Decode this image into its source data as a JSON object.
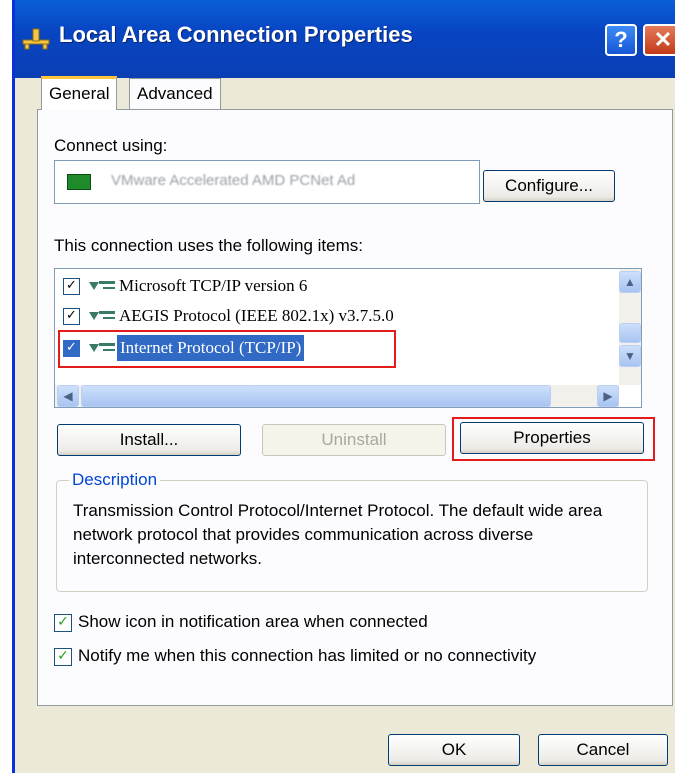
{
  "window": {
    "title": "Local Area Connection Properties",
    "help_glyph": "?",
    "close_glyph": "✕"
  },
  "tabs": [
    {
      "label": "General",
      "active": true
    },
    {
      "label": "Advanced",
      "active": false
    }
  ],
  "connect_using": {
    "label": "Connect using:",
    "device_name": "VMware Accelerated AMD PCNet Ad",
    "configure_button": "Configure..."
  },
  "items_section": {
    "label": "This connection uses the following items:",
    "items": [
      {
        "label": "Microsoft TCP/IP version 6",
        "checked": true,
        "selected": false
      },
      {
        "label": "AEGIS Protocol (IEEE 802.1x) v3.7.5.0",
        "checked": true,
        "selected": false
      },
      {
        "label": "Internet Protocol (TCP/IP)",
        "checked": true,
        "selected": true
      }
    ],
    "check_glyph": "✓",
    "scroll_up_glyph": "▲",
    "scroll_down_glyph": "▼",
    "scroll_left_glyph": "◀",
    "scroll_right_glyph": "▶"
  },
  "buttons": {
    "install": "Install...",
    "uninstall": "Uninstall",
    "properties": "Properties",
    "ok": "OK",
    "cancel": "Cancel"
  },
  "description": {
    "label": "Description",
    "text": "Transmission Control Protocol/Internet Protocol. The default wide area network protocol that provides communication across diverse interconnected networks."
  },
  "options": [
    {
      "label": "Show icon in notification area when connected",
      "checked": true
    },
    {
      "label": "Notify me when this connection has limited or no connectivity",
      "checked": true
    }
  ],
  "colors": {
    "titlebar": "#0a5fd8",
    "selection": "#316ac5",
    "highlight_box": "#e41b1b",
    "groupbox_label": "#0046d5"
  },
  "icons": {
    "title": "network-connection-icon",
    "device": "network-card-icon",
    "protocol": "network-protocol-icon"
  }
}
